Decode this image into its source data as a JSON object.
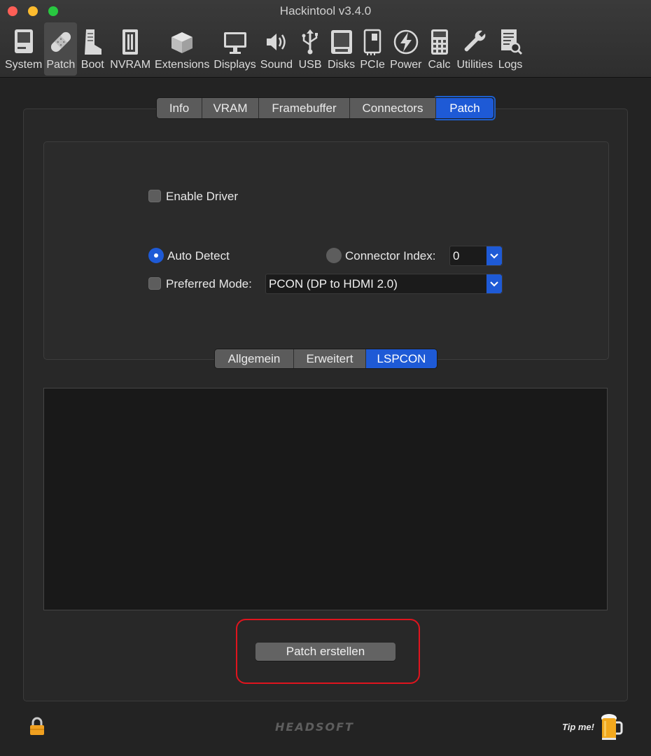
{
  "window": {
    "title": "Hackintool v3.4.0"
  },
  "toolbar": {
    "items": [
      {
        "label": "System",
        "icon": "system-icon"
      },
      {
        "label": "Patch",
        "icon": "bandage-icon",
        "active": true
      },
      {
        "label": "Boot",
        "icon": "boot-icon"
      },
      {
        "label": "NVRAM",
        "icon": "nvram-icon"
      },
      {
        "label": "Extensions",
        "icon": "extensions-icon"
      },
      {
        "label": "Displays",
        "icon": "display-icon"
      },
      {
        "label": "Sound",
        "icon": "speaker-icon"
      },
      {
        "label": "USB",
        "icon": "usb-icon"
      },
      {
        "label": "Disks",
        "icon": "disk-icon"
      },
      {
        "label": "PCIe",
        "icon": "pcie-icon"
      },
      {
        "label": "Power",
        "icon": "power-icon"
      },
      {
        "label": "Calc",
        "icon": "calculator-icon"
      },
      {
        "label": "Utilities",
        "icon": "wrench-icon"
      },
      {
        "label": "Logs",
        "icon": "logs-icon"
      }
    ]
  },
  "tabs": {
    "items": [
      "Info",
      "VRAM",
      "Framebuffer",
      "Connectors",
      "Patch"
    ],
    "selected": "Patch"
  },
  "lspcon": {
    "enable_driver_label": "Enable Driver",
    "enable_driver_checked": false,
    "auto_detect_label": "Auto Detect",
    "auto_detect_selected": true,
    "connector_index_label": "Connector Index:",
    "connector_index_value": "0",
    "preferred_mode_label": "Preferred Mode:",
    "preferred_mode_checked": false,
    "preferred_mode_value": "PCON (DP to HDMI 2.0)"
  },
  "subtabs": {
    "items": [
      "Allgemein",
      "Erweitert",
      "LSPCON"
    ],
    "selected": "LSPCON"
  },
  "output": {
    "text": ""
  },
  "actions": {
    "patch_button": "Patch erstellen"
  },
  "footer": {
    "brand": "HEADSOFT",
    "tip": "Tip me!"
  },
  "colors": {
    "accent": "#1e5ad6",
    "highlight": "#e0141e",
    "background": "#232323"
  }
}
